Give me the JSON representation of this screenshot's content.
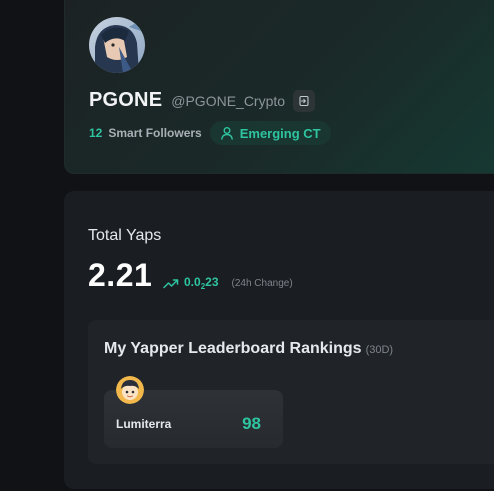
{
  "profile": {
    "display_name": "PGONE",
    "handle": "@PGONE_Crypto",
    "login_icon": "login-icon",
    "smart_followers_count": "12",
    "smart_followers_label": "Smart Followers",
    "tier_icon": "user-icon",
    "tier_label": "Emerging CT"
  },
  "yaps": {
    "title": "Total Yaps",
    "value": "2.21",
    "trend_icon": "trend-up-icon",
    "change_prefix": "0.0",
    "change_subscript": "2",
    "change_suffix": "23",
    "change_label": "(24h Change)"
  },
  "leaderboard": {
    "title": "My Yapper Leaderboard Rankings",
    "period": "(30D)",
    "projects": [
      {
        "name": "Lumiterra",
        "rank": "98"
      }
    ]
  },
  "colors": {
    "accent": "#2ec4a0",
    "background": "#101215",
    "card": "#1a1d21"
  }
}
